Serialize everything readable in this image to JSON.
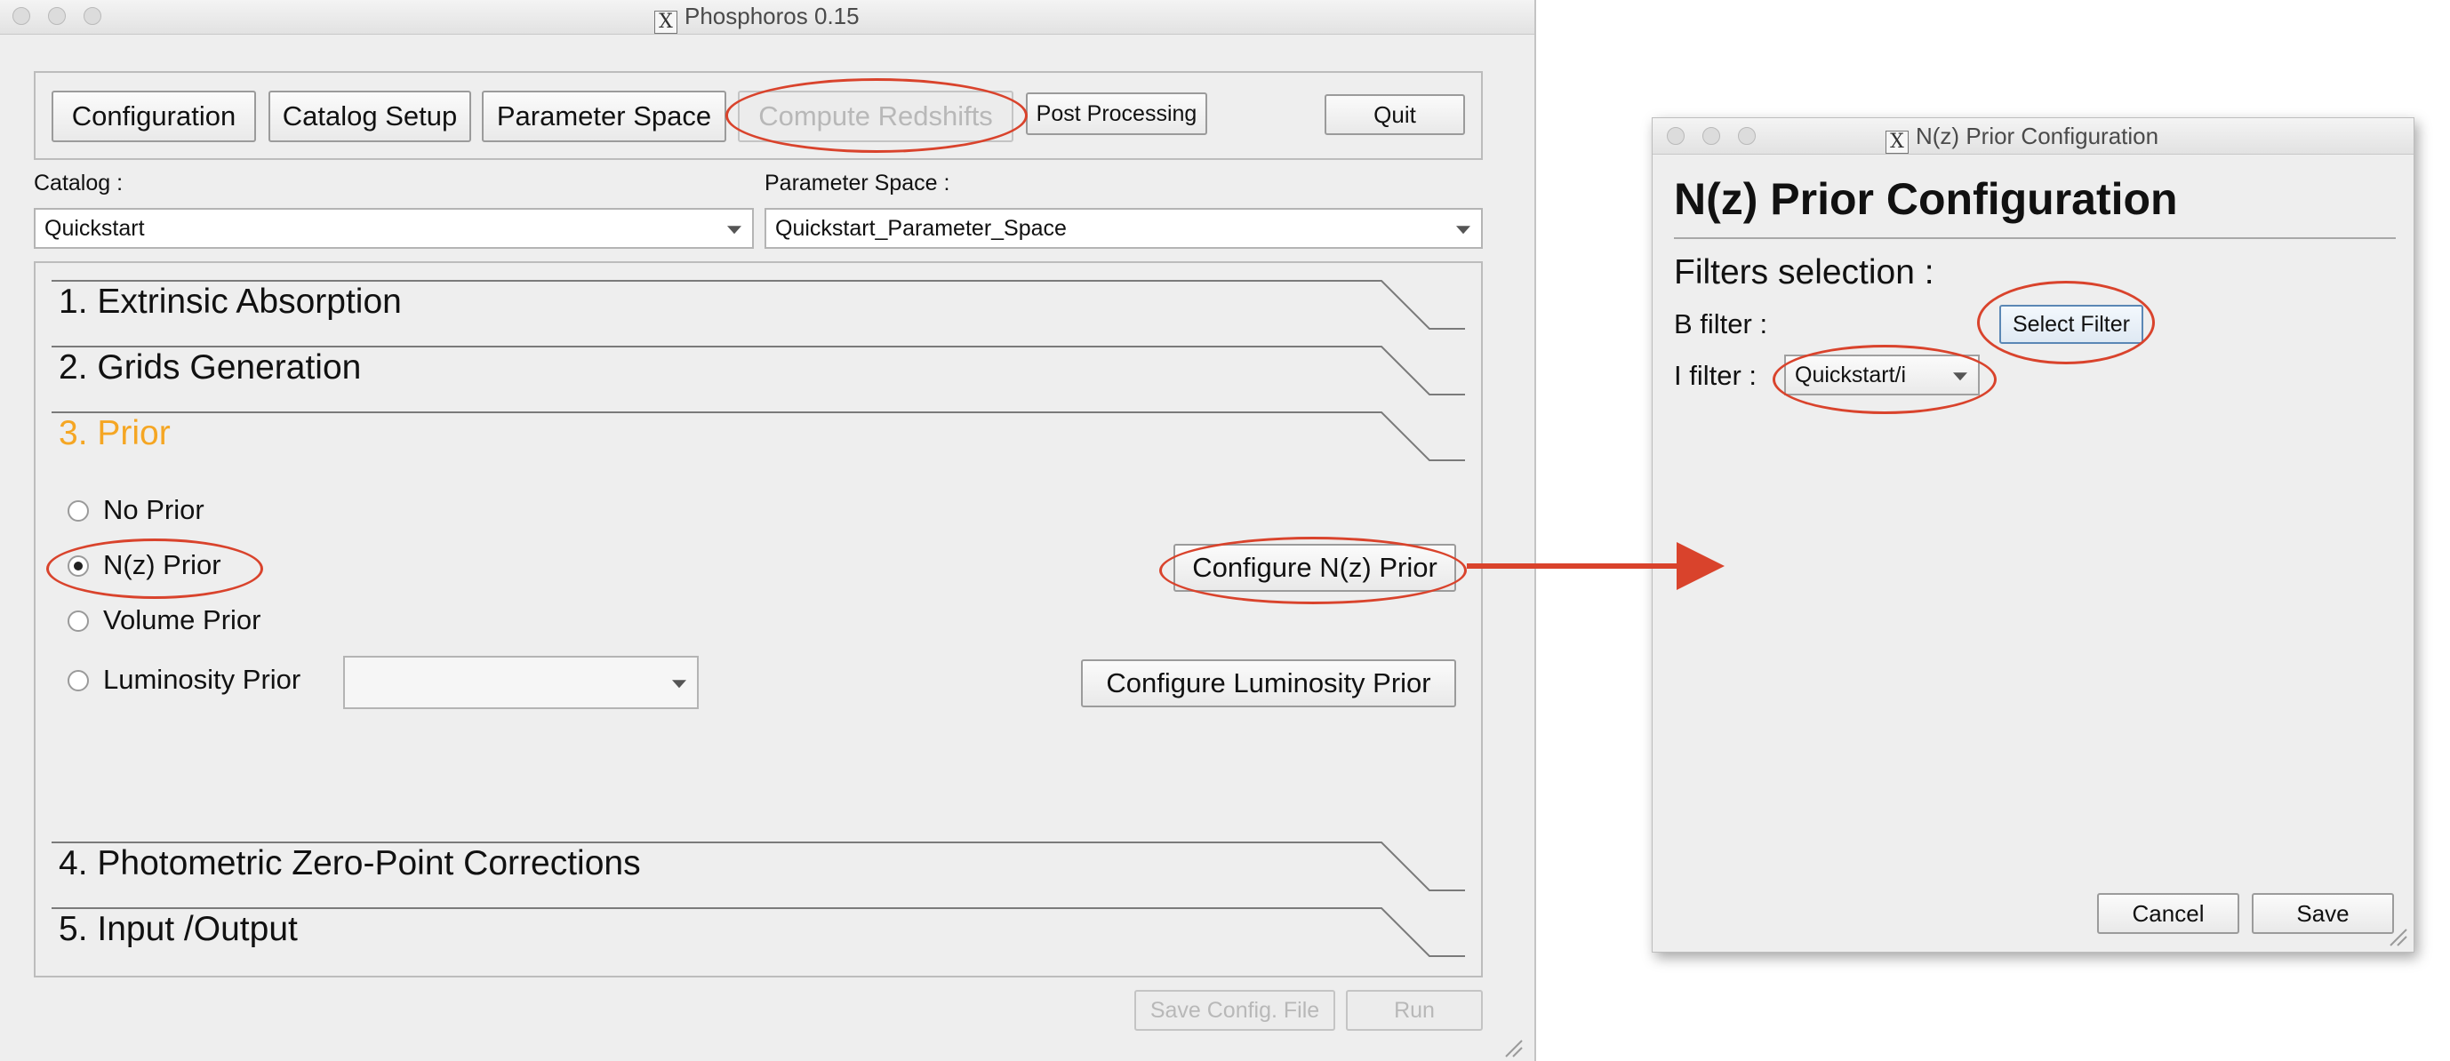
{
  "main_window": {
    "title": "Phosphoros 0.15",
    "toolbar": {
      "configuration": "Configuration",
      "catalog_setup": "Catalog Setup",
      "parameter_space": "Parameter Space",
      "compute_redshifts": "Compute Redshifts",
      "post_processing": "Post Processing",
      "quit": "Quit"
    },
    "catalog": {
      "label": "Catalog :",
      "value": "Quickstart"
    },
    "parameter_space": {
      "label": "Parameter Space :",
      "value": "Quickstart_Parameter_Space"
    },
    "sections": {
      "s1": "1. Extrinsic Absorption",
      "s2": "2. Grids Generation",
      "s3": "3. Prior",
      "s4": "4. Photometric Zero-Point Corrections",
      "s5": "5. Input /Output"
    },
    "prior": {
      "options": {
        "no_prior": "No Prior",
        "nz_prior": "N(z) Prior",
        "volume_prior": "Volume Prior",
        "luminosity_prior": "Luminosity Prior"
      },
      "selected": "N(z) Prior",
      "luminosity_combo_value": "",
      "configure_nz": "Configure N(z) Prior",
      "configure_luminosity": "Configure Luminosity Prior"
    },
    "footer": {
      "save_config": "Save Config. File",
      "run": "Run"
    }
  },
  "dialog": {
    "title": "N(z) Prior Configuration",
    "heading": "N(z) Prior Configuration",
    "filters_heading": "Filters selection :",
    "b_filter_label": "B filter :",
    "select_filter": "Select Filter",
    "i_filter_label": "I filter :",
    "i_filter_value": "Quickstart/i",
    "cancel": "Cancel",
    "save": "Save"
  },
  "colors": {
    "annotation_red": "#d9432c",
    "active_section_orange": "#f5a623",
    "window_bg": "#eeeeee"
  }
}
